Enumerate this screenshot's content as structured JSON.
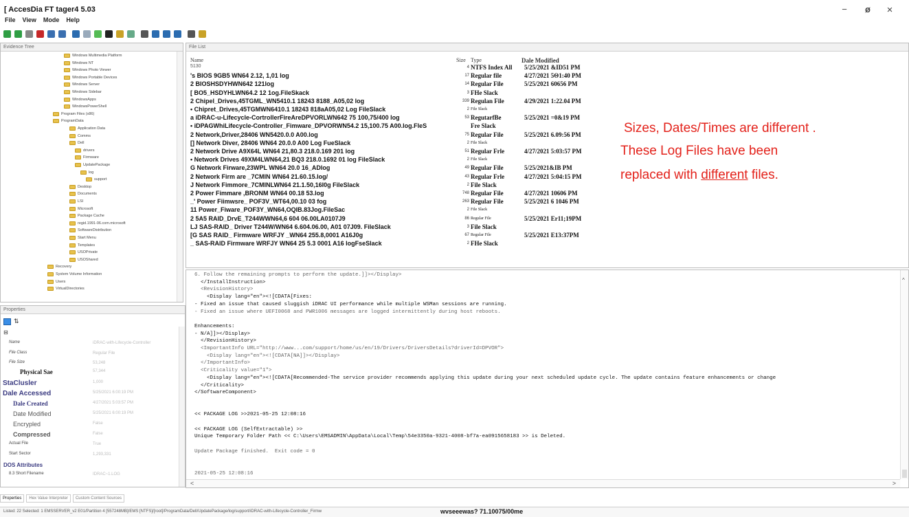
{
  "app": {
    "title": "[ AccesDia FT tager4 5.03",
    "minimize": "−",
    "maximize": "ø",
    "close": "×"
  },
  "menu": [
    "File",
    "View",
    "Mode",
    "Help"
  ],
  "toolbar_icons": [
    "green-db-icon",
    "red-db-icon",
    "gray-icon",
    "red-icon",
    "image-icon",
    "tile-icon",
    "save-icon",
    "cloud-icon",
    "tool-icon",
    "minus-icon",
    "page-icon",
    "search-icon",
    "doc-icon",
    "list-icon",
    "grid-icon",
    "table-icon",
    "tree-icon",
    "key-icon"
  ],
  "panes": {
    "evidence_tree": "Evidence Tree",
    "file_list": "File List",
    "properties": "Properties"
  },
  "tree_items": [
    "Windows Multimedia Platform",
    "Windows NT",
    "Windows Photo Viewer",
    "Windows Portable Devices",
    "Windows Server",
    "Windows Sidebar",
    "WindowsApps",
    "WindowsPowerShell",
    "Program Files (x86)",
    "ProgramData",
    "Application Data",
    "Comms",
    "Dell",
    "drivers",
    "Firmware",
    "UpdatePackage",
    "log",
    "support",
    "Desktop",
    "Documents",
    "LSI",
    "Microsoft",
    "Package Cache",
    "regid.1991-06.com.microsoft",
    "SoftwareDistribution",
    "Start Menu",
    "Templates",
    "USOPrivate",
    "USOShared",
    "Recovery",
    "System Volume Information",
    "Users",
    "VirtualDirectories"
  ],
  "file_columns": {
    "name": "Name",
    "size": "Size",
    "type": "Type",
    "date": "Dale Modified"
  },
  "files": [
    {
      "name": "5130",
      "size": "4",
      "type": "NTFS Index All",
      "date": "5/25/2021 &ID51 PM",
      "small": true
    },
    {
      "name": "'s BIOS 9GB5 WN64 2.12, 1,01 log",
      "size": "17",
      "type": "Regular file",
      "date": "4/27/2021 5Θ1:40 PM"
    },
    {
      "name": "2 BIOSHSDYHWN642 121log",
      "size": "14",
      "type": "Regular File",
      "date": "5/25/2021 60656 PM"
    },
    {
      "name": "[ BO5_HSDYHLWN64.2 12 1og.FileSkack",
      "size": "3",
      "type": "FHe Slack",
      "date": ""
    },
    {
      "name": "2 Chipel_Drives,45TGML_WN5410.1 18243 8188_A05,02 log",
      "size": "339",
      "type": "Regulan File",
      "date": "4/29/2021 1:22.04 PM"
    },
    {
      "name": "• Chipret_Drives,45TGMWN6410.1 18243 818aA05,02 Log FileSlack",
      "size": "2",
      "type": "File Slack",
      "date": "",
      "typeSmall": true
    },
    {
      "name": "a iDRAC-u-Lifecycle-CortrollerFireAreDPVORLWN642 75 100,75/400 log",
      "size": "53",
      "type": "RegutarfBe",
      "date": "5/25/2021 =0&19 PM"
    },
    {
      "name": "• iDPAGWhiLifecycle-Controller_Fimware_DPVORWN54.2 15,100.75 A00.log.FleS",
      "size": "",
      "type": "Fre Slack",
      "date": ""
    },
    {
      "name": "2 Network,Driver,28406 WN5420.0.0 A00.log",
      "size": "75",
      "type": "Regular File",
      "date": "5/25/2021 6.09:56 PM"
    },
    {
      "name": "[] Network Diver, 28406 WN64 20.0.0 A00 Log FueSlack",
      "size": "2",
      "type": "File Slack",
      "date": "",
      "typeSmall": true
    },
    {
      "name": "2 Network Drive A9X64L WN64 21,80.3 218.0.169 201 log",
      "size": "51",
      "type": "Regular Frle",
      "date": "4/27/2021 5:03:57 PM"
    },
    {
      "name": "• Network Drives 49XM4LWN64,21 BQ3 218.0.1692 01 log FileSlack",
      "size": "2",
      "type": "File Slack",
      "date": "",
      "typeSmall": true
    },
    {
      "name": "G Network Firware,23WPL WN64 20.0 16_ADlog",
      "size": "49",
      "type": "Regular File",
      "date": "5/25/2021&IB PM"
    },
    {
      "name": "2 Network Firm are _7CMIN WN64 21.60.15.log/",
      "size": "43",
      "type": "Regular Frle",
      "date": "4/27/2021 5:04:15 PM"
    },
    {
      "name": "J Network Fimmore_7CMINLWN64 21.1.50,16I0g FileSlack",
      "size": "2",
      "type": "File Slack",
      "date": ""
    },
    {
      "name": "2 Power Fimmare ,BRONM WN64 00.18 53.log",
      "size": "748",
      "type": "Regular File",
      "date": "4/27/2021 10606 PM"
    },
    {
      "name": "_' Power Fiimwsre_ POF3V_WT64,00.10 03 fog",
      "size": "263",
      "type": "Regular File",
      "date": "5/25/2021 6 1046 PM"
    },
    {
      "name": "11 Power_Fiware_POF3Y_WN64,OQIB.83Jog.FileSac",
      "size": "2",
      "type": "File Slack",
      "date": "",
      "typeSmall": true
    },
    {
      "name": "2 5A5 RAID_DrvE_T244WWN64,6 604 06.00LA0107J9",
      "size": "86",
      "type": "Regular File",
      "date": "5/25/2021 Er11;19PM",
      "typeSmall": true
    },
    {
      "name": "LJ SAS-RAID_ Driver T244W/WN64 6.604.06.00, A01 07J09. FileSlack",
      "size": "3",
      "type": "File Slack",
      "date": ""
    },
    {
      "name": "[G SAS RAID_ Firmware WRFJY _WN64 255.8,0001 A16J0g",
      "size": "67",
      "type": "Regular File",
      "date": "5/25/2021 E13:37PM",
      "typeSmall": true
    },
    {
      "name": "_ SAS-RAID Firmware WRFJY WN64 25 5.3 0001 A16 logFseSlack",
      "size": "2",
      "type": "FHe Slack",
      "date": ""
    }
  ],
  "annotation": {
    "line1": "Sizes, Dates/Times are different .",
    "line2": "These Log Files have been",
    "line3_prefix": "replaced with ",
    "line3_underlined": "different",
    "line3_suffix": " files."
  },
  "viewer_lines": [
    {
      "text": "6. Follow the remaining prompts to perform the update.]]></Display>",
      "faint": true
    },
    {
      "text": "  </InstallInstruction>"
    },
    {
      "text": "  <RevisionHistory>",
      "faint": true
    },
    {
      "text": "    <Display lang=\"en\"><![CDATA[Fixes:"
    },
    {
      "text": "- Fixed an issue that caused sluggish iDRAC UI performance while multiple WSMan sessions are running."
    },
    {
      "text": "- Fixed an issue where UEFI0068 and PWR1006 messages are logged intermittently during host reboots.",
      "faint": true
    },
    {
      "text": ""
    },
    {
      "text": "Enhancements:"
    },
    {
      "text": "- N/A]]></Display>"
    },
    {
      "text": "  </RevisionHistory>"
    },
    {
      "text": "  <ImportantInfo URL=\"http://www...com/support/home/us/en/19/Drivers/DriversDetails?driverId=DPVOR\">",
      "faint": true
    },
    {
      "text": "    <Display lang=\"en\"><![CDATA[NA]]></Display>",
      "faint": true
    },
    {
      "text": "  </ImportantInfo>",
      "faint": true
    },
    {
      "text": "  <Criticality value=\"1\">",
      "faint": true
    },
    {
      "text": "    <Display lang=\"en\"><![CDATA[Recommended-The service provider recommends applying this update during your next scheduled update cycle. The update contains feature enhancements or change"
    },
    {
      "text": "  </Criticality>"
    },
    {
      "text": "</SoftwareComponent>"
    },
    {
      "text": ""
    },
    {
      "text": ""
    },
    {
      "text": "<< PACKAGE LOG >>2021-05-25 12:08:16"
    },
    {
      "text": ""
    },
    {
      "text": "<< PACKAGE LOG (SelfExtractable) >>"
    },
    {
      "text": "Unique Temporary Folder Path << C:\\Users\\EMSADMIN\\AppData\\Local\\Temp\\54e3350a-9321-4008-bf7a-ea0915658183 >> is Deleted."
    },
    {
      "text": ""
    },
    {
      "text": "Update Package finished.  Exit code = 0",
      "faint": true
    },
    {
      "text": ""
    },
    {
      "text": ""
    },
    {
      "text": "2021-05-25 12:08:16",
      "faint": true
    }
  ],
  "properties": [
    {
      "label": "Name",
      "value": "iDRAC-with-Lifecycle-Controller"
    },
    {
      "label": "File Class",
      "value": "Regular File"
    },
    {
      "label": "File Size",
      "value": "53,248"
    },
    {
      "label": "Physical Sae",
      "value": "57,344"
    },
    {
      "label": "StaClusler",
      "value": "1,000"
    },
    {
      "label": "Dale Accessed",
      "value": "5/25/2021 6:00:19 PM"
    },
    {
      "label": "Dale Created",
      "value": "4/27/2021 5:03:57 PM"
    },
    {
      "label": "Date Modified",
      "value": "5/25/2021 6:00:19 PM"
    },
    {
      "label": "Encrypled",
      "value": "False"
    },
    {
      "label": "Compressed",
      "value": "False"
    },
    {
      "label": "Actual File",
      "value": "True"
    },
    {
      "label": "Start Sector",
      "value": "1,293,331"
    },
    {
      "label": "DOS Attributes",
      "value": ""
    },
    {
      "label": "8.3 Short Filename",
      "value": "IDRAC~1.LOG"
    }
  ],
  "bottom_tabs": [
    "Properties",
    "Hex Value Interpreter",
    "Custom Content Sources"
  ],
  "status": {
    "left": "Listed: 22  Selected: 1  EMSSERVER_v2 E01/Partition 4 [557248MB]/EMS [NTFS]/[root]/ProgramData/Dell/UpdatePackage/log/support/iDRAC-with-Lifecycle-Controller_Firmw",
    "right": "wvseeewas? 71.10075/00me"
  }
}
